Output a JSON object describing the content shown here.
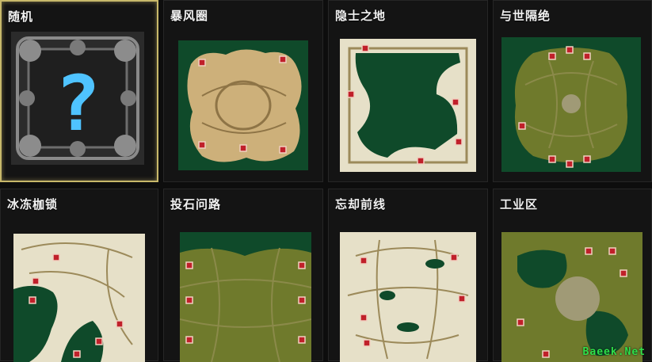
{
  "maps": [
    {
      "name": "随机",
      "selected": true
    },
    {
      "name": "暴风圈",
      "selected": false
    },
    {
      "name": "隐士之地",
      "selected": false
    },
    {
      "name": "与世隔绝",
      "selected": false
    },
    {
      "name": "冰冻枷锁",
      "selected": false
    },
    {
      "name": "投石问路",
      "selected": false
    },
    {
      "name": "忘却前线",
      "selected": false
    },
    {
      "name": "工业区",
      "selected": false
    }
  ],
  "random_glyph": "?",
  "watermark": "Baeek.Net",
  "colors": {
    "selected_border": "#c8b86a",
    "forest": "#0f4a2a",
    "sand": "#cdb07a",
    "snow": "#e6e0c8",
    "grass": "#6f7a2c",
    "start_marker": "#c0202a",
    "question_mark": "#4fc3ff"
  }
}
